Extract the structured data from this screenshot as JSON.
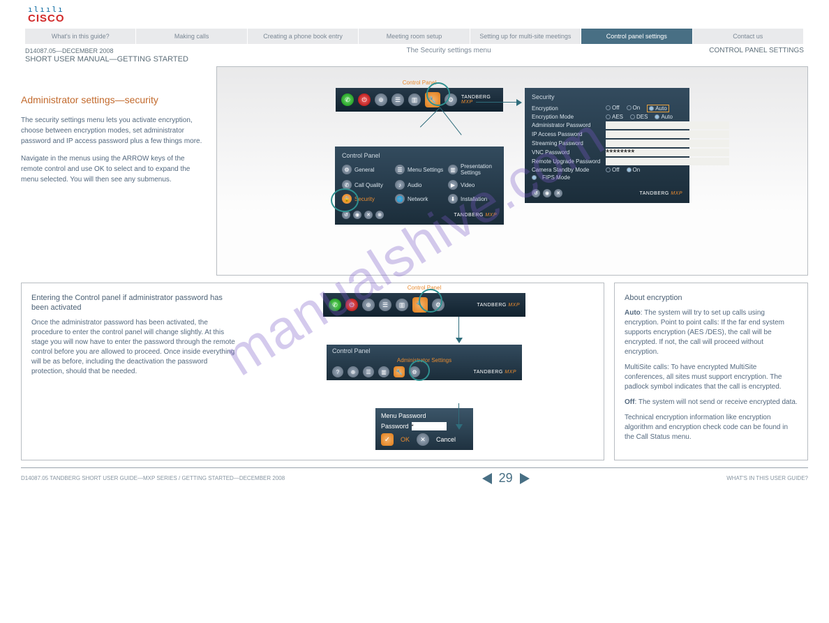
{
  "header": {
    "brand_bars": "ılıılı",
    "brand_text": "CISCO",
    "product": "TANDBERG",
    "product_suffix": "MXP"
  },
  "topnav": {
    "items": [
      "What's in this guide?",
      "Making calls",
      "Creating a phone book entry",
      "Meeting room setup",
      "Setting up for multi-site meetings",
      "Control panel settings",
      "Contact us"
    ],
    "active_index": 5
  },
  "subhead": {
    "left_date": "D14087.05—DECEMBER 2008",
    "left_title": "SHORT USER MANUAL—GETTING STARTED",
    "center": "The Security settings menu",
    "right": "CONTROL PANEL SETTINGS"
  },
  "sidebar": {
    "title": "Administrator settings—security",
    "p1": "The security settings menu lets you activate encryption, choose between encryption modes, set administrator password and IP access password plus a few things more.",
    "p2": "Navigate in the menus using the ARROW keys of the remote control and use OK to select and to expand the menu selected. You will then see any submenus."
  },
  "tb_top": {
    "title": "Control Panel",
    "brand": "TANDBERG",
    "suffix": "MXP"
  },
  "control_panel": {
    "header": "Control Panel",
    "items": [
      "General",
      "Menu Settings",
      "Presentation Settings",
      "Call Quality",
      "Audio",
      "Video",
      "Security",
      "Network",
      "Installation"
    ]
  },
  "security_panel": {
    "header": "Security",
    "rows": [
      {
        "label": "Encryption",
        "type": "radio3",
        "opts": [
          "Off",
          "On",
          "Auto"
        ],
        "sel": 2,
        "highlight": true
      },
      {
        "label": "Encryption Mode",
        "type": "radio3",
        "opts": [
          "AES",
          "DES",
          "Auto"
        ],
        "sel": 2
      },
      {
        "label": "Administrator Password",
        "type": "input",
        "value": ""
      },
      {
        "label": "IP Access Password",
        "type": "input",
        "value": ""
      },
      {
        "label": "Streaming Password",
        "type": "input",
        "value": ""
      },
      {
        "label": "VNC Password",
        "type": "input",
        "value": "********"
      },
      {
        "label": "Remote Upgrade Password",
        "type": "input",
        "value": ""
      },
      {
        "label": "Camera Standby Mode",
        "type": "radio2",
        "opts": [
          "Off",
          "On"
        ],
        "sel": 1
      },
      {
        "label": "FIPS Mode",
        "type": "bullet"
      }
    ]
  },
  "lower_left": {
    "title": "Entering the Control panel if administrator password has been activated",
    "body": "Once the administrator password has been activated, the procedure to enter the control panel will change slightly. At this stage you will now have to enter the password through the remote control before you are allowed to proceed. Once inside everything will be as before, including the deactivation the password protection, should that be needed.",
    "admin_title": "Control Panel",
    "admin_sub": "Administrator Settings",
    "dialog_title": "Menu Password",
    "pw_label": "Password",
    "pw_value": "*",
    "ok": "OK",
    "cancel": "Cancel"
  },
  "lower_right": {
    "title": "About encryption",
    "auto_label": "Auto",
    "auto_text": ": The system will try to set up calls using encryption. Point to point calls: If the far end system supports encryption (AES /DES), the call will be encrypted. If not, the call will proceed without encryption.",
    "multi_text": "MultiSite calls: To have encrypted MultiSite conferences, all sites must support encryption. The padlock symbol indicates that the call is encrypted.",
    "off_label": "Off",
    "off_text": ": The system will not send or receive encrypted data.",
    "note": "Technical encryption information like encryption algorithm and encryption check code can be found in the Call Status menu."
  },
  "footer": {
    "left": "D14087.05 TANDBERG SHORT USER GUIDE—MXP SERIES / GETTING STARTED—DECEMBER 2008",
    "page": "29",
    "right": "WHAT'S IN THIS USER GUIDE?"
  },
  "watermark": "manualshive.com"
}
